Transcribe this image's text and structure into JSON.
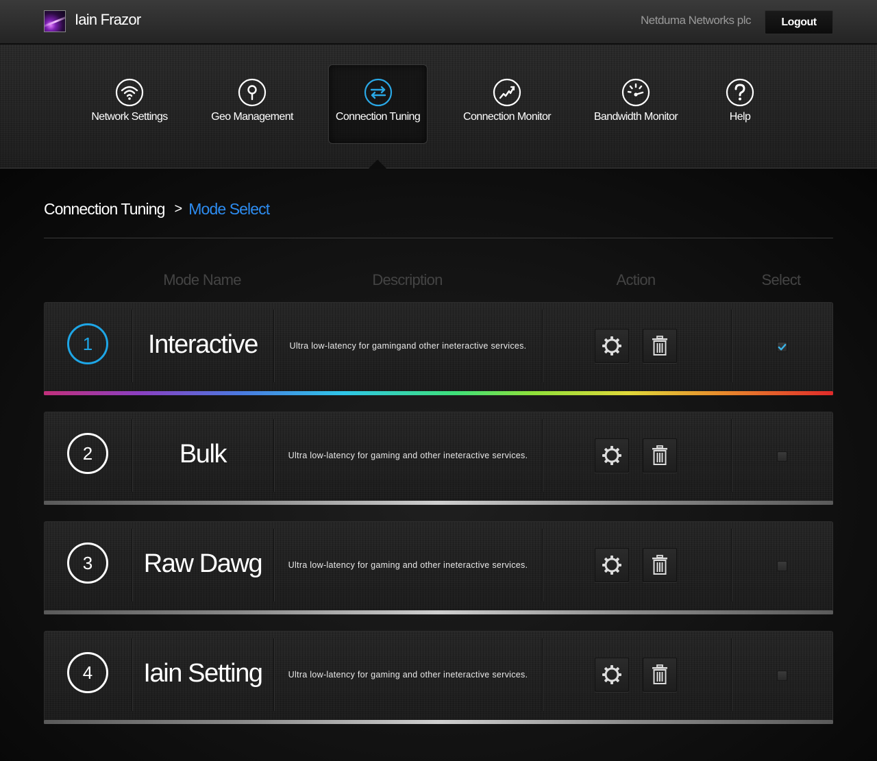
{
  "user": {
    "name": "Iain Frazor"
  },
  "header": {
    "company": "Netduma Networks plc",
    "logout_label": "Logout"
  },
  "nav": [
    {
      "label": "Network Settings",
      "icon": "wifi-icon"
    },
    {
      "label": "Geo Management",
      "icon": "map-pin-icon"
    },
    {
      "label": "Connection Tuning",
      "icon": "swap-arrows-icon",
      "active": true
    },
    {
      "label": "Connection Monitor",
      "icon": "line-chart-icon"
    },
    {
      "label": "Bandwidth Monitor",
      "icon": "speedometer-icon"
    },
    {
      "label": "Help",
      "icon": "help-icon"
    }
  ],
  "breadcrumb": {
    "parent": "Connection Tuning",
    "separator": ">",
    "current": "Mode Select"
  },
  "table": {
    "headers": {
      "mode_name": "Mode Name",
      "description": "Description",
      "action": "Action",
      "select": "Select"
    },
    "rows": [
      {
        "number": "1",
        "name": "Interactive",
        "description": "Ultra low-latency for gamingand other ineteractive services.",
        "selected": true,
        "active": true
      },
      {
        "number": "2",
        "name": "Bulk",
        "description": "Ultra low-latency for gaming and other ineteractive services.",
        "selected": false
      },
      {
        "number": "3",
        "name": "Raw Dawg",
        "description": "Ultra low-latency for gaming and other ineteractive services.",
        "selected": false
      },
      {
        "number": "4",
        "name": "Iain Setting",
        "description": "Ultra low-latency for gaming and other ineteractive services.",
        "selected": false
      }
    ]
  },
  "colors": {
    "accent_blue": "#2d8cf0",
    "active_circle": "#1ea6e6",
    "check": "#3ab4e8"
  }
}
